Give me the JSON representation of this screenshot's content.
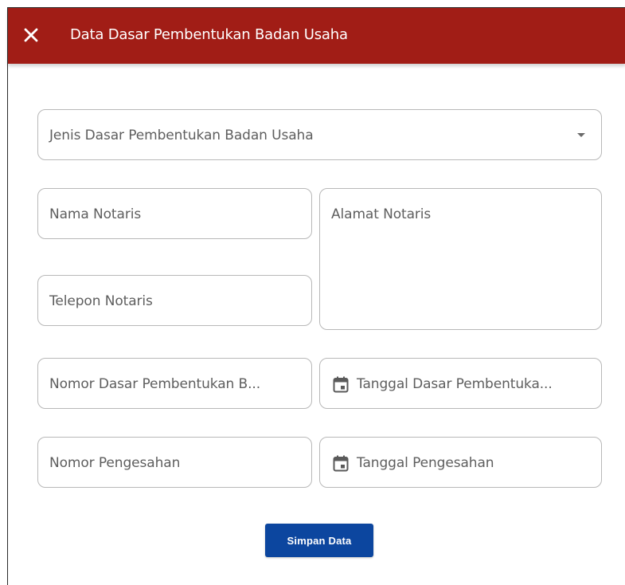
{
  "header": {
    "title": "Data Dasar Pembentukan Badan Usaha",
    "close_icon": "close-icon",
    "color": "#a11d16"
  },
  "form": {
    "jenis_dasar": {
      "label": "Jenis Dasar Pembentukan Badan Usaha",
      "icon": "chevron-down-icon"
    },
    "nama_notaris": {
      "label": "Nama Notaris"
    },
    "alamat_notaris": {
      "label": "Alamat Notaris"
    },
    "telepon_notaris": {
      "label": "Telepon Notaris"
    },
    "nomor_dasar": {
      "label": "Nomor Dasar Pembentukan B..."
    },
    "tanggal_dasar": {
      "label": "Tanggal Dasar Pembentuka...",
      "icon": "calendar-icon"
    },
    "nomor_pengesahan": {
      "label": "Nomor Pengesahan"
    },
    "tanggal_pengesahan": {
      "label": "Tanggal Pengesahan",
      "icon": "calendar-icon"
    }
  },
  "actions": {
    "save_label": "Simpan Data",
    "color": "#0c469f"
  }
}
